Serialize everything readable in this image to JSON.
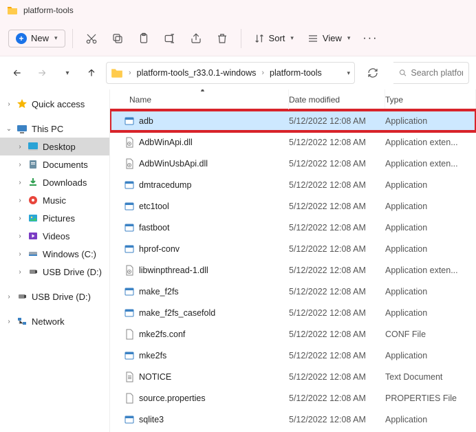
{
  "window": {
    "title": "platform-tools"
  },
  "toolbar": {
    "new_label": "New",
    "sort_label": "Sort",
    "view_label": "View"
  },
  "breadcrumb": {
    "seg1": "platform-tools_r33.0.1-windows",
    "seg2": "platform-tools"
  },
  "search": {
    "placeholder": "Search platform-"
  },
  "sidebar": {
    "quick_access": "Quick access",
    "this_pc": "This PC",
    "desktop": "Desktop",
    "documents": "Documents",
    "downloads": "Downloads",
    "music": "Music",
    "pictures": "Pictures",
    "videos": "Videos",
    "windows_c": "Windows (C:)",
    "usb_d": "USB Drive (D:)",
    "usb_d2": "USB Drive (D:)",
    "network": "Network"
  },
  "columns": {
    "name": "Name",
    "date": "Date modified",
    "type": "Type"
  },
  "files": [
    {
      "name": "adb",
      "date": "5/12/2022 12:08 AM",
      "type": "Application",
      "icon": "exe",
      "selected": true,
      "highlighted": true
    },
    {
      "name": "AdbWinApi.dll",
      "date": "5/12/2022 12:08 AM",
      "type": "Application exten...",
      "icon": "dll"
    },
    {
      "name": "AdbWinUsbApi.dll",
      "date": "5/12/2022 12:08 AM",
      "type": "Application exten...",
      "icon": "dll"
    },
    {
      "name": "dmtracedump",
      "date": "5/12/2022 12:08 AM",
      "type": "Application",
      "icon": "exe"
    },
    {
      "name": "etc1tool",
      "date": "5/12/2022 12:08 AM",
      "type": "Application",
      "icon": "exe"
    },
    {
      "name": "fastboot",
      "date": "5/12/2022 12:08 AM",
      "type": "Application",
      "icon": "exe"
    },
    {
      "name": "hprof-conv",
      "date": "5/12/2022 12:08 AM",
      "type": "Application",
      "icon": "exe"
    },
    {
      "name": "libwinpthread-1.dll",
      "date": "5/12/2022 12:08 AM",
      "type": "Application exten...",
      "icon": "dll"
    },
    {
      "name": "make_f2fs",
      "date": "5/12/2022 12:08 AM",
      "type": "Application",
      "icon": "exe"
    },
    {
      "name": "make_f2fs_casefold",
      "date": "5/12/2022 12:08 AM",
      "type": "Application",
      "icon": "exe"
    },
    {
      "name": "mke2fs.conf",
      "date": "5/12/2022 12:08 AM",
      "type": "CONF File",
      "icon": "file"
    },
    {
      "name": "mke2fs",
      "date": "5/12/2022 12:08 AM",
      "type": "Application",
      "icon": "exe"
    },
    {
      "name": "NOTICE",
      "date": "5/12/2022 12:08 AM",
      "type": "Text Document",
      "icon": "txt"
    },
    {
      "name": "source.properties",
      "date": "5/12/2022 12:08 AM",
      "type": "PROPERTIES File",
      "icon": "file"
    },
    {
      "name": "sqlite3",
      "date": "5/12/2022 12:08 AM",
      "type": "Application",
      "icon": "exe"
    }
  ]
}
